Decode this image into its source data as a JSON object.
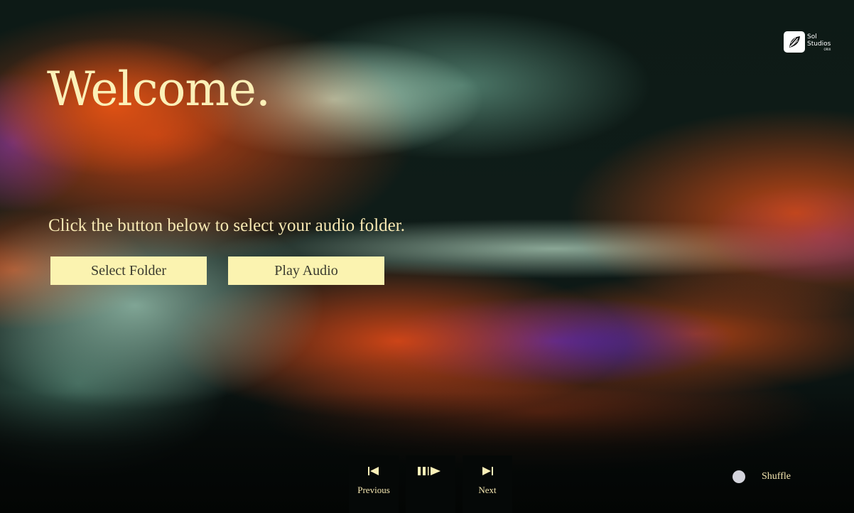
{
  "brand": {
    "name_line1": "Sol",
    "name_line2": "Studios",
    "name_line3": "ORIX"
  },
  "main": {
    "title": "Welcome.",
    "instruction": "Click the button below to select your audio folder.",
    "select_folder_label": "Select Folder",
    "play_audio_label": "Play Audio"
  },
  "player": {
    "previous_label": "Previous",
    "next_label": "Next",
    "shuffle_label": "Shuffle",
    "shuffle_on": false
  },
  "colors": {
    "accent_cream": "#fbf3b0",
    "title_cream": "#fbf0b8",
    "control_bg": "#050807",
    "orange": "#e2521a",
    "blue": "#3c24cd",
    "mint": "#c3eed4"
  }
}
